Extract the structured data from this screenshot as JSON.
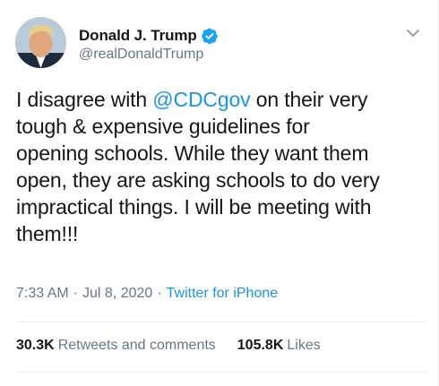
{
  "author": {
    "display_name": "Donald J. Trump",
    "handle": "@realDonaldTrump",
    "verified": true
  },
  "tweet": {
    "text_before": "I disagree with ",
    "mention": "@CDCgov",
    "text_after": " on their very\ntough & expensive guidelines for\nopening schools. While they want them\nopen, they are asking schools to do very\nimpractical things. I will be meeting with\nthem!!!",
    "time": "7:33 AM",
    "separator": "·",
    "date": "Jul 8, 2020",
    "source": "Twitter for iPhone"
  },
  "stats": {
    "retweets_count": "30.3K",
    "retweets_label": "Retweets and comments",
    "likes_count": "105.8K",
    "likes_label": "Likes"
  },
  "colors": {
    "link": "#1b95e0",
    "muted": "#657786",
    "text": "#14171a",
    "verified": "#1da1f2"
  },
  "icons": [
    "avatar-image",
    "verified-badge-icon",
    "chevron-down-icon"
  ]
}
